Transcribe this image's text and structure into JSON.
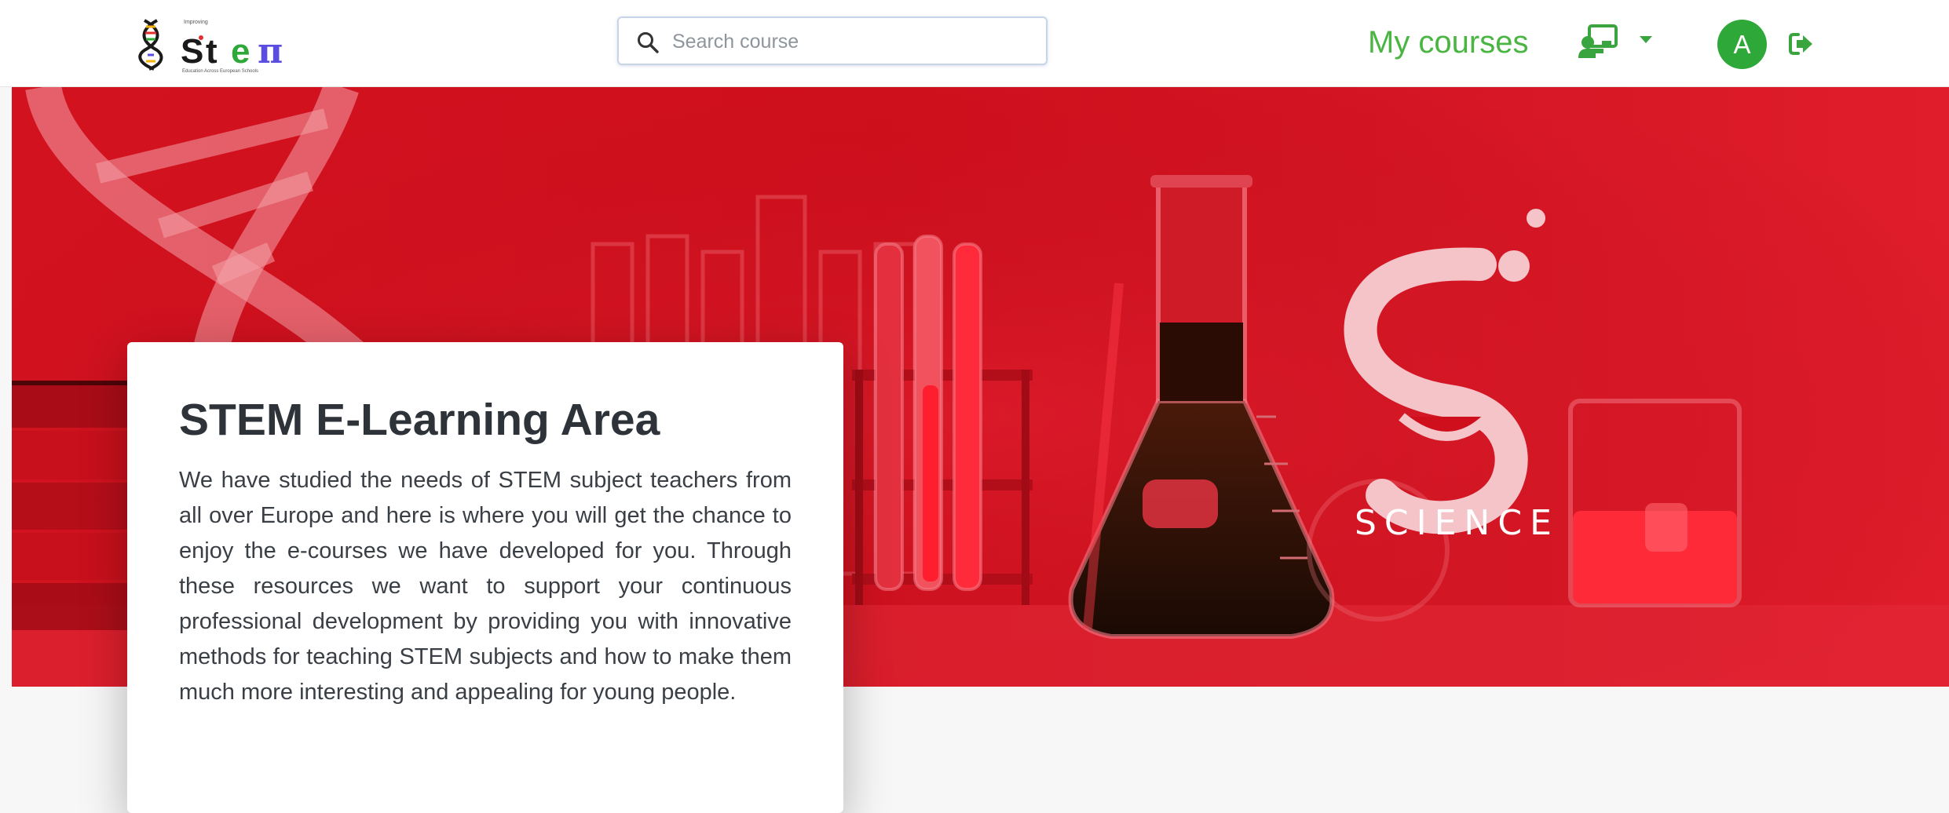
{
  "logo": {
    "tagline_top": "Improving",
    "tagline_bottom": "Education Across European Schools",
    "brand_colors": [
      "#1a1a1a",
      "#f6b10f",
      "#2fa83a",
      "#5b4de0"
    ]
  },
  "search": {
    "placeholder": "Search course",
    "icon": "search-icon"
  },
  "nav": {
    "my_courses_label": "My courses",
    "teacher_menu_icon": "chalkboard-teacher-icon",
    "avatar_initial": "A",
    "logout_icon": "logout-icon"
  },
  "hero": {
    "science_label": "SCIENCE",
    "background_color": "#d3121f"
  },
  "card": {
    "title": "STEM E-Learning Area",
    "body": "We have studied the needs of STEM subject teachers from all over Europe and here is where you will get the chance to enjoy the e-courses we have developed for you. Through these resources we want to support your continuous professional development by providing you with innovative methods for teaching STEM subjects and how to make them much more interesting and appealing for young people."
  },
  "colors": {
    "accent_green": "#4bb543",
    "hero_red": "#d3121f",
    "title_text": "#2e333a"
  }
}
